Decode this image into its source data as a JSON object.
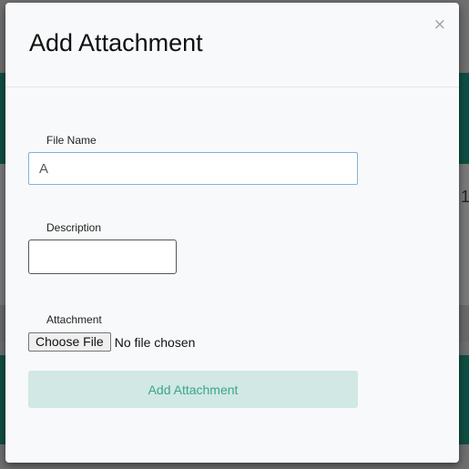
{
  "modal": {
    "title": "Add Attachment",
    "close_label": "×"
  },
  "form": {
    "file_name": {
      "label": "File Name",
      "value": "A"
    },
    "description": {
      "label": "Description",
      "value": ""
    },
    "attachment": {
      "label": "Attachment",
      "button_label": "Choose File",
      "status_text": "No file chosen"
    },
    "submit_label": "Add Attachment"
  },
  "background": {
    "partial_text": "1"
  },
  "colors": {
    "submit_bg": "#d1e8e4",
    "submit_text": "#3aa58c",
    "input_focus_border": "#7fb3dd",
    "background_band": "#0f4f43"
  },
  "icons": {
    "close": "close-icon"
  }
}
